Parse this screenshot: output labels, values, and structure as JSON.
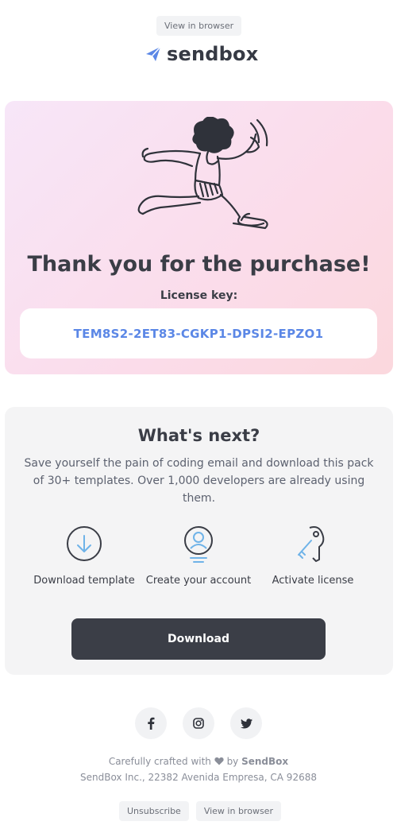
{
  "header": {
    "view_in_browser": "View in browser",
    "brand": "sendbox"
  },
  "hero": {
    "title": "Thank you for the purchase!",
    "license_label": "License key:",
    "license_key": "TEM8S2-2ET83-CGKP1-DPSI2-EPZO1"
  },
  "next": {
    "title": "What's next?",
    "description": "Save yourself the pain of coding email and download this pack of 30+ templates. Over 1,000 developers are already using them.",
    "steps": [
      {
        "label": "Download template",
        "icon": "download-icon"
      },
      {
        "label": "Create your account",
        "icon": "user-icon"
      },
      {
        "label": "Activate license",
        "icon": "key-icon"
      }
    ],
    "download_label": "Download"
  },
  "footer": {
    "socials": [
      "facebook-icon",
      "instagram-icon",
      "twitter-icon"
    ],
    "credit_prefix": "Carefully crafted with",
    "credit_by": "by",
    "credit_brand": "SendBox",
    "address": "SendBox Inc., 22382 Avenida Empresa, CA 92688",
    "unsubscribe": "Unsubscribe",
    "view_in_browser": "View in browser"
  },
  "colors": {
    "accent": "#5b87e6",
    "button": "#3b3e47",
    "icon_blue": "#6fb3e8"
  }
}
